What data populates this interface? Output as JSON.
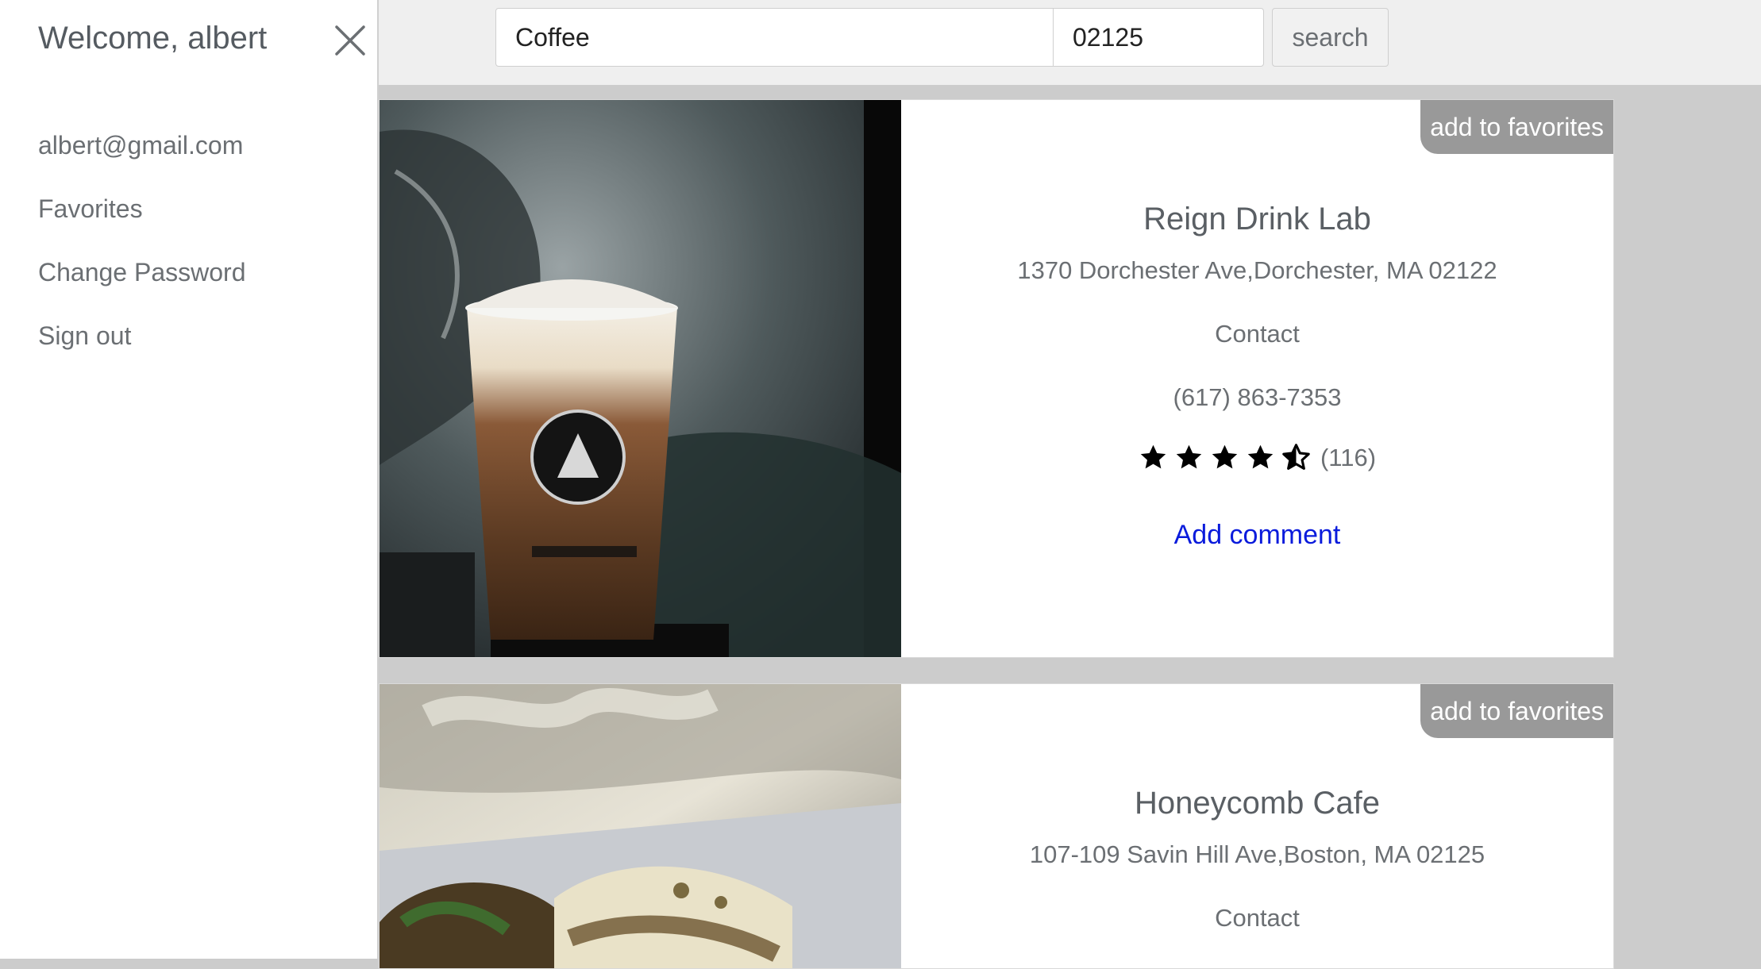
{
  "sidebar": {
    "welcome": "Welcome, albert",
    "links": [
      {
        "label": "albert@gmail.com"
      },
      {
        "label": "Favorites"
      },
      {
        "label": "Change Password"
      },
      {
        "label": "Sign out"
      }
    ]
  },
  "search": {
    "query": "Coffee",
    "zip": "02125",
    "button_label": "search"
  },
  "results": [
    {
      "fav_label": "add to favorites",
      "name": "Reign Drink Lab",
      "address": "1370 Dorchester Ave,Dorchester, MA 02122",
      "contact_label": "Contact",
      "phone": "(617) 863-7353",
      "rating": 4.5,
      "review_count": "(116)",
      "comment_label": "Add comment",
      "photo_subject": "iced-coffee-cup"
    },
    {
      "fav_label": "add to favorites",
      "name": "Honeycomb Cafe",
      "address": "107-109 Savin Hill Ave,Boston, MA 02125",
      "contact_label": "Contact",
      "photo_subject": "breakfast-plate"
    }
  ],
  "colors": {
    "accent_link": "#0a1bdc",
    "fav_button": "#999999",
    "backdrop": "#cccccc"
  }
}
